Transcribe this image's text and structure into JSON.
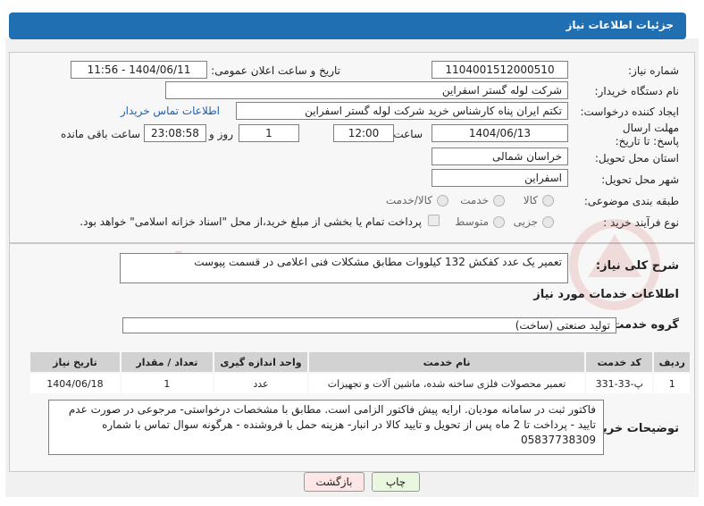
{
  "header": {
    "title": "جزئیات اطلاعات نیاز"
  },
  "fields": {
    "need_number_label": "شماره نیاز:",
    "need_number": "1104001512000510",
    "announce_label": "تاریخ و ساعت اعلان عمومی:",
    "announce_value": "1404/06/11 - 11:56",
    "buyer_org_label": "نام دستگاه خریدار:",
    "buyer_org": "شرکت لوله گستر اسفراین",
    "requester_label": "ایجاد کننده درخواست:",
    "requester": "تکتم ایران پناه کارشناس خرید شرکت لوله گستر اسفراین",
    "buyer_contact_link": "اطلاعات تماس خریدار",
    "deadline_label": "مهلت ارسال پاسخ: تا تاریخ:",
    "deadline_date": "1404/06/13",
    "hour_label": "ساعت",
    "deadline_time": "12:00",
    "days_value": "1",
    "days_label": "روز و",
    "remaining_time": "23:08:58",
    "remaining_label": "ساعت باقی مانده",
    "province_label": "استان محل تحویل:",
    "province": "خراسان شمالی",
    "city_label": "شهر محل تحویل:",
    "city": "اسفراین",
    "category_label": "طبقه بندی موضوعی:",
    "category_options": [
      "کالا",
      "خدمت",
      "کالا/خدمت"
    ],
    "purchase_type_label": "نوع فرآیند خرید :",
    "purchase_type_options": [
      "جزیی",
      "متوسط"
    ],
    "payment_note": "پرداخت تمام یا بخشی از مبلغ خرید،از محل \"اسناد خزانه اسلامی\" خواهد بود."
  },
  "summary": {
    "label": "شرح کلی نیاز:",
    "text": "تعمیر یک عدد کفکش 132 کیلووات مطابق مشکلات فنی اعلامی در قسمت پیوست"
  },
  "services": {
    "section_title": "اطلاعات خدمات مورد نیاز",
    "group_label": "گروه خدمت:",
    "group_value": "تولید صنعتی (ساخت)",
    "columns": [
      "ردیف",
      "کد خدمت",
      "نام خدمت",
      "واحد اندازه گیری",
      "تعداد / مقدار",
      "تاریخ نیاز"
    ],
    "rows": [
      [
        "1",
        "پ-33-331",
        "تعمیر محصولات فلزی ساخته شده، ماشین آلات و تجهیزات",
        "عدد",
        "1",
        "1404/06/18"
      ]
    ]
  },
  "notes": {
    "label": "توضیحات خریدار:",
    "text": "فاکتور ثبت در سامانه مودیان. ارایه پیش فاکتور الزامی است. مطابق با مشخصات درخواستی- مرجوعی در صورت عدم تایید - پرداخت تا 2 ماه پس از تحویل و تایید کالا در انبار- هزینه حمل با فروشنده - هرگونه سوال تماس با شماره 05837738309"
  },
  "buttons": {
    "print": "چاپ",
    "back": "بازگشت"
  },
  "watermark": {
    "text": "AriaTender.neT"
  },
  "colors": {
    "title_bar": "#1f6fb2",
    "print_button": "#e8f7dd",
    "back_button": "#fde6e6",
    "watermark": "#c62828"
  }
}
